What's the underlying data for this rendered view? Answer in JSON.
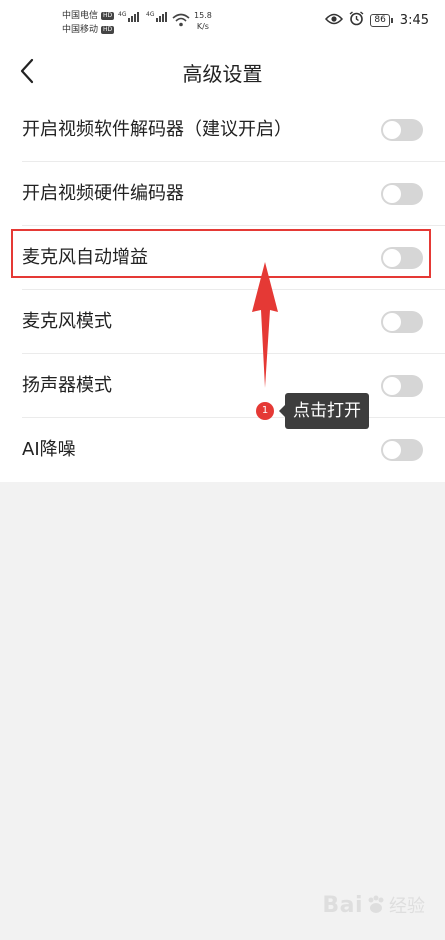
{
  "status_bar": {
    "carrier_1": "中国电信",
    "carrier_2": "中国移动",
    "hd_label": "HD",
    "network_1": "4G",
    "network_2": "4G",
    "net_speed_value": "15.8",
    "net_speed_unit": "K/s",
    "battery": "86",
    "time": "3:45"
  },
  "header": {
    "title": "高级设置",
    "back_icon": "chevron-left-icon"
  },
  "settings": [
    {
      "label": "开启视频软件解码器（建议开启）",
      "enabled": false
    },
    {
      "label": "开启视频硬件编码器",
      "enabled": false
    },
    {
      "label": "麦克风自动增益",
      "enabled": false
    },
    {
      "label": "麦克风模式",
      "enabled": false
    },
    {
      "label": "扬声器模式",
      "enabled": false
    },
    {
      "label": "AI降噪",
      "enabled": false
    }
  ],
  "annotation": {
    "step_number": "1",
    "tooltip_text": "点击打开",
    "highlight_color": "#e53935",
    "target_setting": "麦克风自动增益"
  },
  "watermark": {
    "brand": "Bai",
    "suffix": "经验"
  },
  "colors": {
    "toggle_off": "#d6d6d6",
    "accent_red": "#e53935",
    "tooltip_bg": "#3d3d3d"
  }
}
